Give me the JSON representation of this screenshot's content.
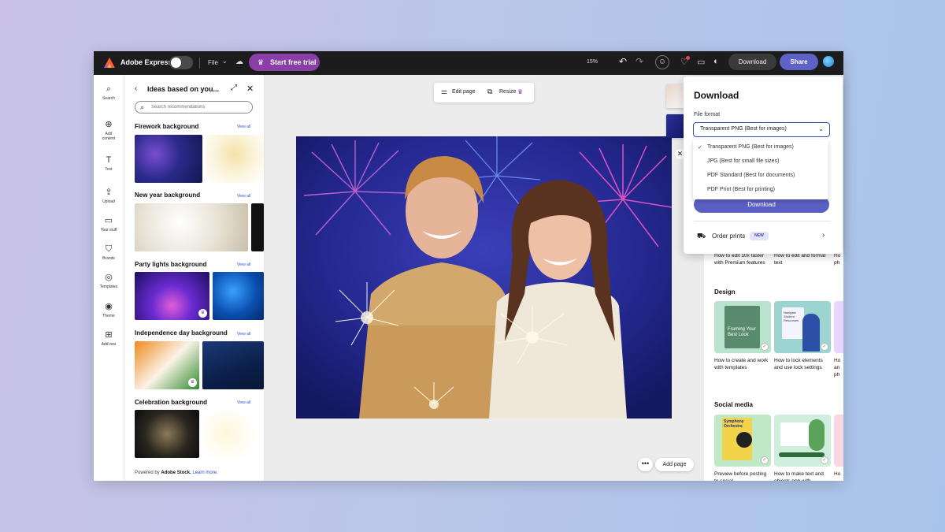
{
  "app": {
    "name": "Adobe Express",
    "file_menu": "File",
    "trial_button": "Start free trial",
    "zoom": "15%",
    "download_button": "Download",
    "share_button": "Share"
  },
  "rail": [
    {
      "label": "Search",
      "icon": "search-icon"
    },
    {
      "label": "Add content",
      "icon": "add-icon"
    },
    {
      "label": "Text",
      "icon": "text-icon"
    },
    {
      "label": "Upload",
      "icon": "upload-icon"
    },
    {
      "label": "Your stuff",
      "icon": "folder-icon"
    },
    {
      "label": "Brands",
      "icon": "brand-icon"
    },
    {
      "label": "Templates",
      "icon": "templates-icon"
    },
    {
      "label": "Theme",
      "icon": "theme-icon"
    },
    {
      "label": "Add-ons",
      "icon": "addons-icon"
    }
  ],
  "panel": {
    "title": "Ideas based on you...",
    "search_placeholder": "Search recommendations",
    "view_all": "View all",
    "categories": [
      {
        "title": "Firework background"
      },
      {
        "title": "New year background"
      },
      {
        "title": "Party lights background"
      },
      {
        "title": "Independence day background"
      },
      {
        "title": "Celebration background"
      }
    ],
    "footer_prefix": "Powered by",
    "footer_brand": "Adobe Stock.",
    "footer_link": "Learn more."
  },
  "canvas": {
    "edit_page": "Edit page",
    "resize": "Resize",
    "add_page": "Add page"
  },
  "download_panel": {
    "title": "Download",
    "file_format_label": "File format",
    "selected": "Transparent PNG (Best for images)",
    "options": [
      "Transparent PNG (Best for images)",
      "JPG (Best for small file sizes)",
      "PDF Standard (Best for documents)",
      "PDF Print (Best for printing)"
    ],
    "download_button": "Download",
    "order_prints": "Order prints",
    "new_badge": "NEW"
  },
  "learn": {
    "top_captions": [
      "How to edit 10x faster with Premium features",
      "How to edit and format text",
      "Ho ph"
    ],
    "design_header": "Design",
    "design_cards": [
      {
        "caption": "How to create and work with templates",
        "card_text": "Framing Your Best Look"
      },
      {
        "caption": "How to lock elements and use lock settings",
        "card_text": "Navigate Student Resources"
      },
      {
        "caption": "Ho an ph"
      }
    ],
    "social_header": "Social media",
    "social_cards": [
      {
        "caption": "Preview before posting to social",
        "card_text": "Symphony Orchestra"
      },
      {
        "caption": "How to make text and objects pop with",
        "card_text": ""
      },
      {
        "caption": "Ho"
      }
    ]
  },
  "colors": {
    "topbar": "#1c1c1c",
    "accent": "#5e61c5",
    "trial": "#8a3ea8",
    "link": "#2a4fd6"
  }
}
